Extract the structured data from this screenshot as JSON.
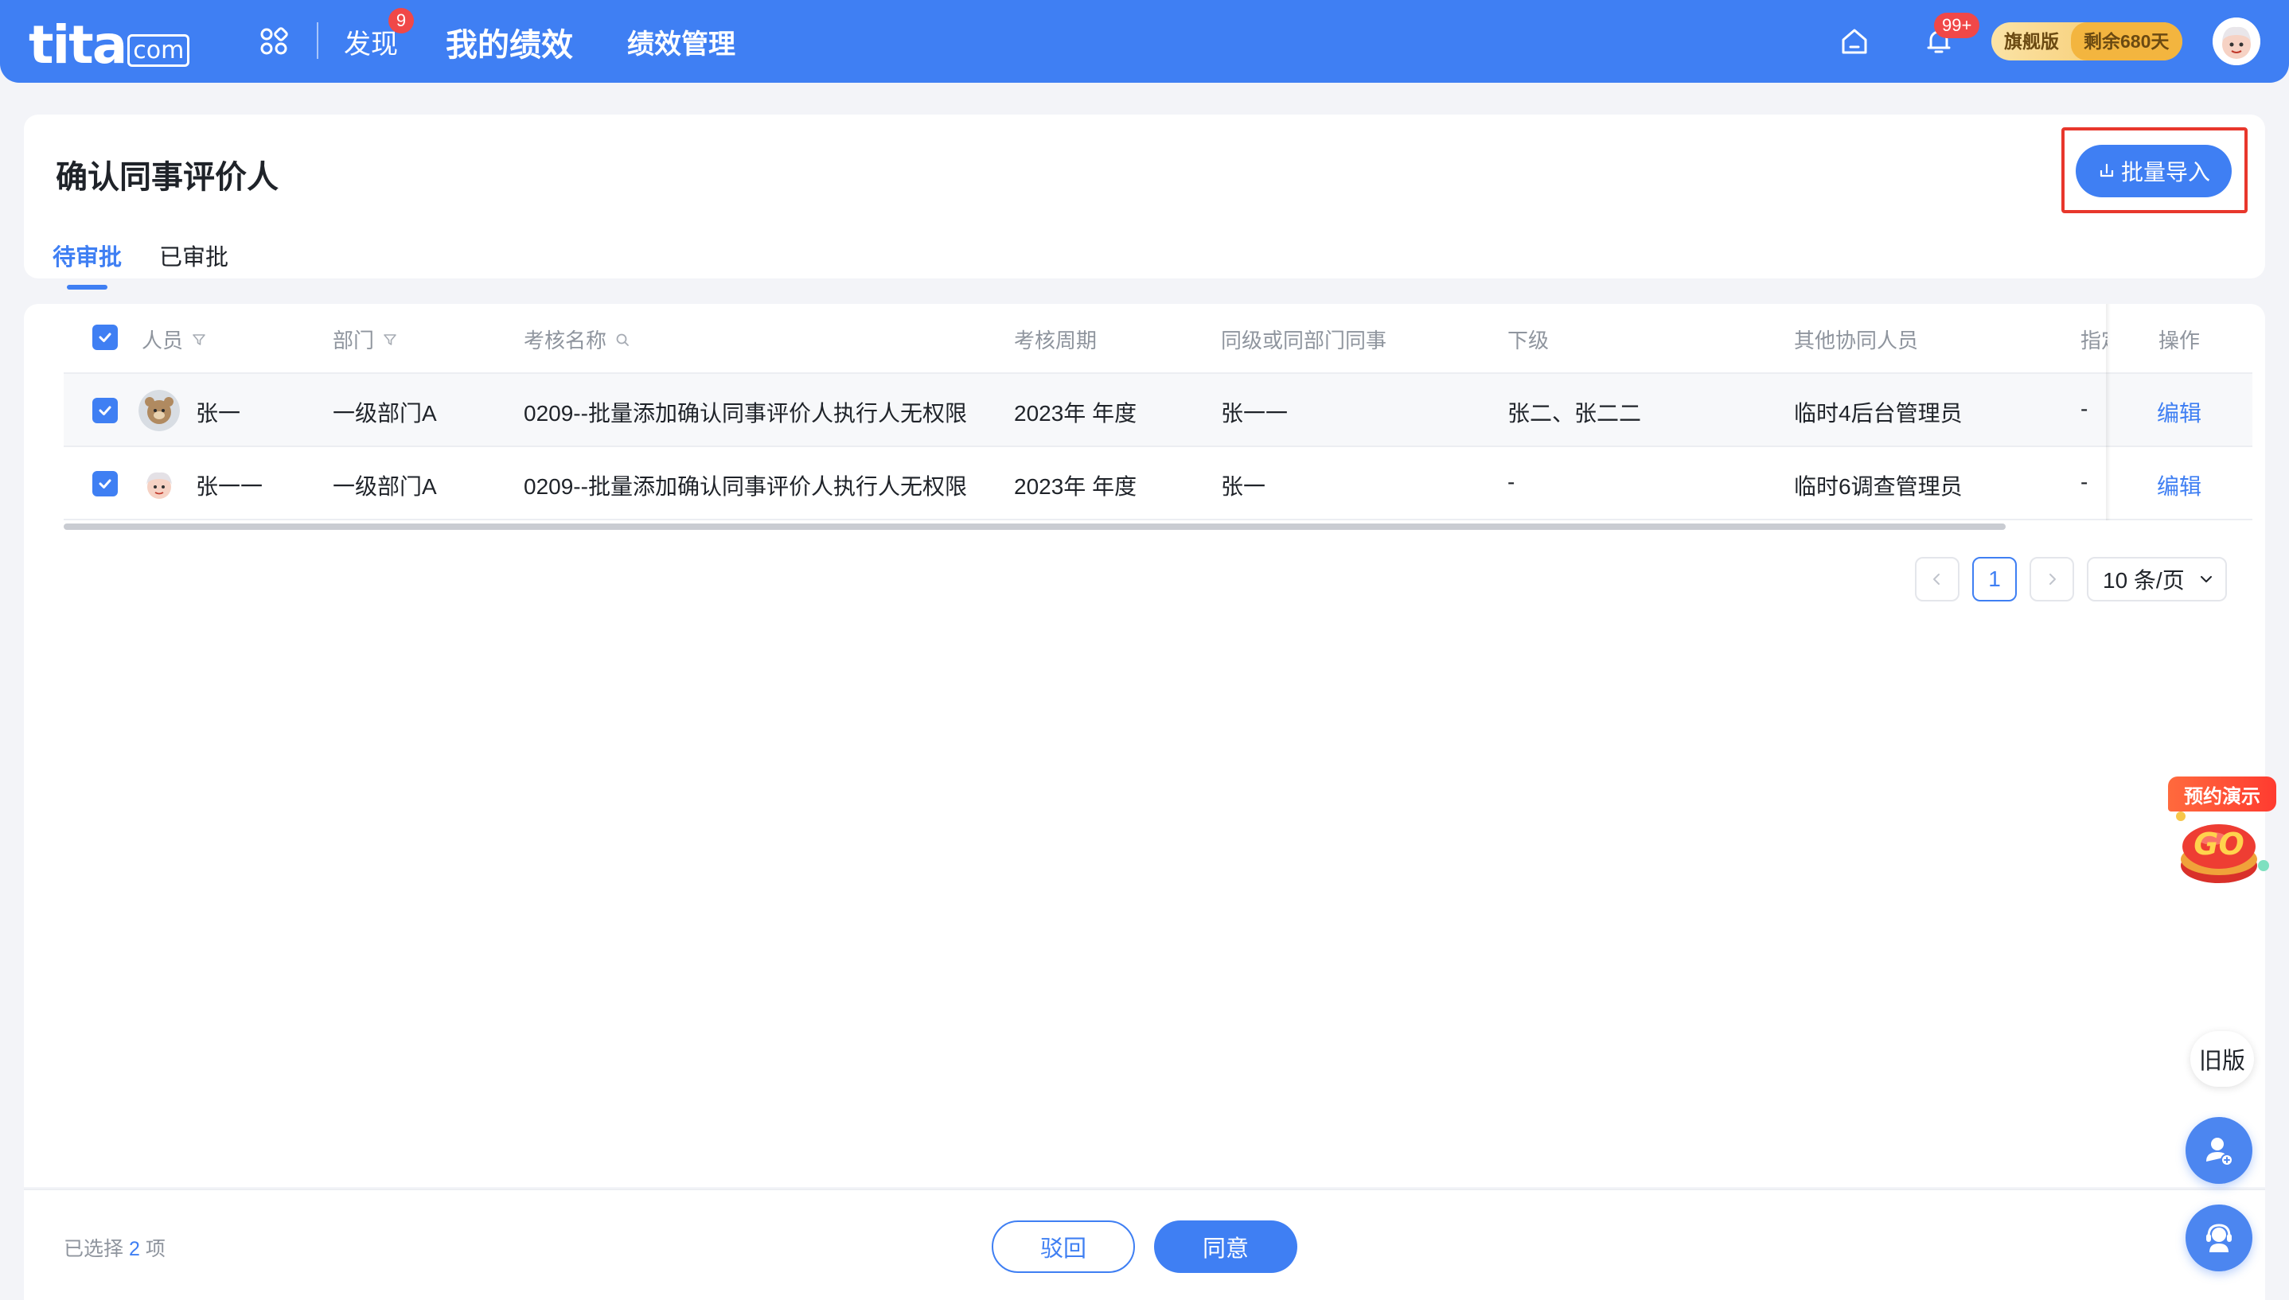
{
  "nav": {
    "logo": "tita",
    "logo_suffix": "com",
    "discover": "发现",
    "discover_badge": "9",
    "my_performance": "我的绩效",
    "performance_management": "绩效管理",
    "notification_badge": "99+",
    "plan_name": "旗舰版",
    "plan_remaining": "剩余680天"
  },
  "header": {
    "title": "确认同事评价人",
    "import_button": "批量导入",
    "tabs": [
      {
        "label": "待审批",
        "active": true
      },
      {
        "label": "已审批",
        "active": false
      }
    ]
  },
  "table": {
    "columns": {
      "person": "人员",
      "department": "部门",
      "review_name": "考核名称",
      "review_cycle": "考核周期",
      "peers": "同级或同部门同事",
      "subordinates": "下级",
      "others": "其他协同人员",
      "designated": "指定",
      "actions": "操作"
    },
    "rows": [
      {
        "selected": true,
        "person": "张一",
        "department": "一级部门A",
        "review_name": "0209--批量添加确认同事评价人执行人无权限",
        "review_cycle": "2023年 年度",
        "peers": "张一一",
        "subordinates": "张二、张二二",
        "others": "临时4后台管理员",
        "designated": "-",
        "action": "编辑"
      },
      {
        "selected": true,
        "person": "张一一",
        "department": "一级部门A",
        "review_name": "0209--批量添加确认同事评价人执行人无权限",
        "review_cycle": "2023年 年度",
        "peers": "张一",
        "subordinates": "-",
        "others": "临时6调查管理员",
        "designated": "-",
        "action": "编辑"
      }
    ]
  },
  "pagination": {
    "current_page": "1",
    "page_size": "10 条/页"
  },
  "footer": {
    "selected_prefix": "已选择",
    "selected_count": "2",
    "selected_suffix": "项",
    "reject_button": "驳回",
    "agree_button": "同意"
  },
  "floating": {
    "demo_label": "预约演示",
    "demo_go": "GO",
    "old_version": "旧版"
  },
  "colors": {
    "primary": "#3f7ff3",
    "highlight_border": "#e8372c",
    "badge": "#f04848",
    "plan_gold": "#f3b53f"
  }
}
